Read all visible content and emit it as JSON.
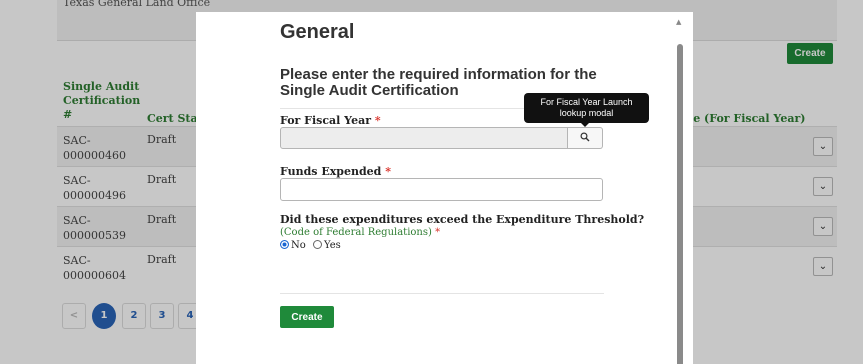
{
  "background": {
    "top_card_text": "Texas General Land Office",
    "create_label": "Create",
    "columns": [
      "Single Audit Certification #",
      "Cert Status",
      "ate (For Fiscal Year)"
    ],
    "rows": [
      {
        "id": "SAC-000000460",
        "status": "Draft"
      },
      {
        "id": "SAC-000000496",
        "status": "Draft"
      },
      {
        "id": "SAC-000000539",
        "status": "Draft"
      },
      {
        "id": "SAC-000000604",
        "status": "Draft"
      }
    ],
    "pagination": {
      "prev": "<",
      "pages": [
        "1",
        "2",
        "3",
        "4"
      ],
      "current": "1"
    }
  },
  "modal": {
    "title": "General",
    "subtitle": "Please enter the required information for the Single Audit Certification",
    "fiscal_year_label": "For Fiscal Year",
    "required_mark": "*",
    "lookup_icon": "search-icon",
    "lookup_tooltip": "For Fiscal Year Launch lookup modal",
    "funds_label": "Funds Expended",
    "question": "Did these expenditures exceed the Expenditure Threshold?",
    "cfr_link": "(Code of Federal Regulations)",
    "radio_options": [
      "No",
      "Yes"
    ],
    "radio_selected": "No",
    "create_label": "Create"
  },
  "colors": {
    "accent_green": "#1f8a3a",
    "label_green": "#2e7d32",
    "required_red": "#d9332b",
    "page_blue": "#2a64b8"
  }
}
